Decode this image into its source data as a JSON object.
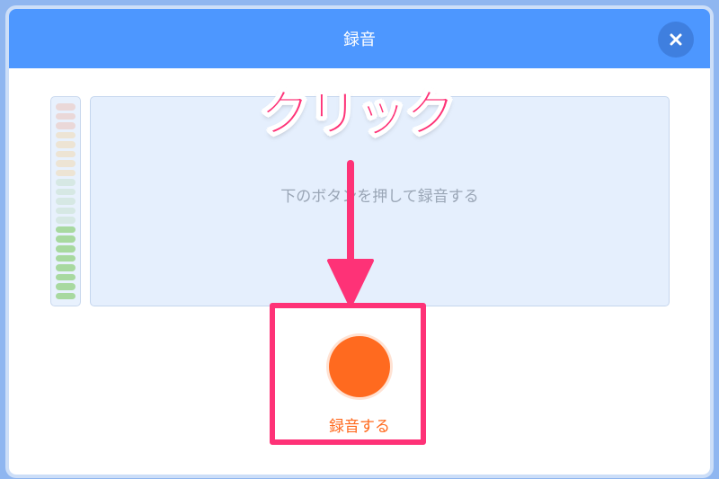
{
  "dialog": {
    "title": "録音",
    "close_icon": "close-icon",
    "header_color": "#4d97ff"
  },
  "level_meter": {
    "colors": [
      "#ead8d8",
      "#ead8d8",
      "#ead8d8",
      "#ede4d4",
      "#ede4d4",
      "#ede4d4",
      "#ede4d4",
      "#ede4d4",
      "#d6e8e4",
      "#d6e8e4",
      "#d6e8e4",
      "#d6e8e4",
      "#d6e8e4",
      "#a8d9a0",
      "#a8d9a0",
      "#a8d9a0",
      "#a8d9a0",
      "#a8d9a0",
      "#a8d9a0",
      "#a8d9a0",
      "#a8d9a0"
    ]
  },
  "recording_area": {
    "message": "下のボタンを押して録音する"
  },
  "record_button": {
    "label": "録音する",
    "icon": "record-circle-icon",
    "color": "#ff6a1f"
  },
  "annotation": {
    "text": "クリック",
    "color": "#fe3277",
    "arrow_icon": "arrow-down-icon"
  }
}
